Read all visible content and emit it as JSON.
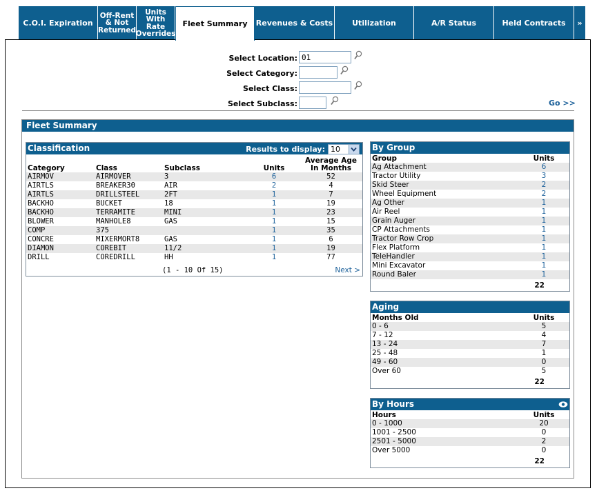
{
  "tabs": [
    {
      "label": "C.O.I. Expiration"
    },
    {
      "label": "Off-Rent & Not Returned"
    },
    {
      "label": "Units With Rate Overrides"
    },
    {
      "label": "Fleet Summary"
    },
    {
      "label": "Revenues & Costs"
    },
    {
      "label": "Utilization"
    },
    {
      "label": "A/R Status"
    },
    {
      "label": "Held Contracts"
    },
    {
      "label": "»"
    }
  ],
  "filters": {
    "location_label": "Select Location:",
    "location_value": "01",
    "category_label": "Select Category:",
    "category_value": "",
    "class_label": "Select Class:",
    "class_value": "",
    "subclass_label": "Select Subclass:",
    "subclass_value": "",
    "go_label": "Go >>"
  },
  "fleet": {
    "title": "Fleet Summary",
    "classification": {
      "title": "Classification",
      "results_label": "Results to display:",
      "results_value": "10",
      "headers": [
        "Category",
        "Class",
        "Subclass",
        "Units",
        "Average Age In Months"
      ],
      "rows": [
        [
          "AIRMOV",
          "AIRMOVER",
          "3",
          "6",
          "52"
        ],
        [
          "AIRTLS",
          "BREAKER30",
          "AIR",
          "2",
          "4"
        ],
        [
          "AIRTLS",
          "DRILLSTEEL",
          "2FT",
          "1",
          "7"
        ],
        [
          "BACKHO",
          "BUCKET",
          "18",
          "1",
          "19"
        ],
        [
          "BACKHO",
          "TERRAMITE",
          "MINI",
          "1",
          "23"
        ],
        [
          "BLOWER",
          "MANHOLE8",
          "GAS",
          "1",
          "15"
        ],
        [
          "COMP",
          "375",
          "",
          "1",
          "35"
        ],
        [
          "CONCRE",
          "MIXERMORT8",
          "GAS",
          "1",
          "6"
        ],
        [
          "DIAMON",
          "COREBIT",
          "11/2",
          "1",
          "19"
        ],
        [
          "DRILL",
          "COREDRILL",
          "HH",
          "1",
          "77"
        ]
      ],
      "pager": "(1 - 10 Of 15)",
      "next_label": "Next >"
    },
    "by_group": {
      "title": "By Group",
      "headers": [
        "Group",
        "Units"
      ],
      "rows": [
        [
          "Ag Attachment",
          "6"
        ],
        [
          "Tractor Utility",
          "3"
        ],
        [
          "Skid Steer",
          "2"
        ],
        [
          "Wheel Equipment",
          "2"
        ],
        [
          "Ag Other",
          "1"
        ],
        [
          "Air Reel",
          "1"
        ],
        [
          "Grain Auger",
          "1"
        ],
        [
          "CP Attachments",
          "1"
        ],
        [
          "Tractor Row Crop",
          "1"
        ],
        [
          "Flex Platform",
          "1"
        ],
        [
          "TeleHandler",
          "1"
        ],
        [
          "Mini Excavator",
          "1"
        ],
        [
          "Round Baler",
          "1"
        ]
      ],
      "total": "22"
    },
    "aging": {
      "title": "Aging",
      "headers": [
        "Months Old",
        "Units"
      ],
      "rows": [
        [
          "0 - 6",
          "5"
        ],
        [
          "7 - 12",
          "4"
        ],
        [
          "13 - 24",
          "7"
        ],
        [
          "25 - 48",
          "1"
        ],
        [
          "49 - 60",
          "0"
        ],
        [
          "Over 60",
          "5"
        ]
      ],
      "total": "22"
    },
    "by_hours": {
      "title": "By Hours",
      "headers": [
        "Hours",
        "Units"
      ],
      "rows": [
        [
          "0 - 1000",
          "20"
        ],
        [
          "1001 - 2500",
          "0"
        ],
        [
          "2501 - 5000",
          "2"
        ],
        [
          "Over 5000",
          "0"
        ]
      ],
      "total": "22"
    }
  },
  "colors": {
    "header_blue": "#0e5f8f",
    "link_blue": "#1a5f99",
    "row_alt": "#e8e8e8"
  }
}
